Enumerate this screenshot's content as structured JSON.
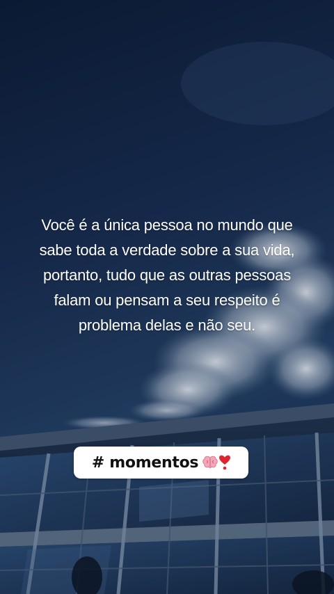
{
  "story": {
    "quote_lines": [
      "Você é a única pessoa no mundo que",
      "sabe toda a verdade sobre a sua vida,",
      "portanto, tudo que as outras pessoas",
      "falam ou pensam a seu respeito é",
      "problema delas e não seu."
    ],
    "hashtag_sticker": {
      "text": "# momentos",
      "emoji_icons": [
        "brain-icon",
        "heart-exclamation-icon"
      ]
    }
  },
  "colors": {
    "sky_top": "#0b1a33",
    "sky_mid": "#1a3150",
    "sticker_bg": "#ffffff",
    "text": "#ffffff"
  }
}
